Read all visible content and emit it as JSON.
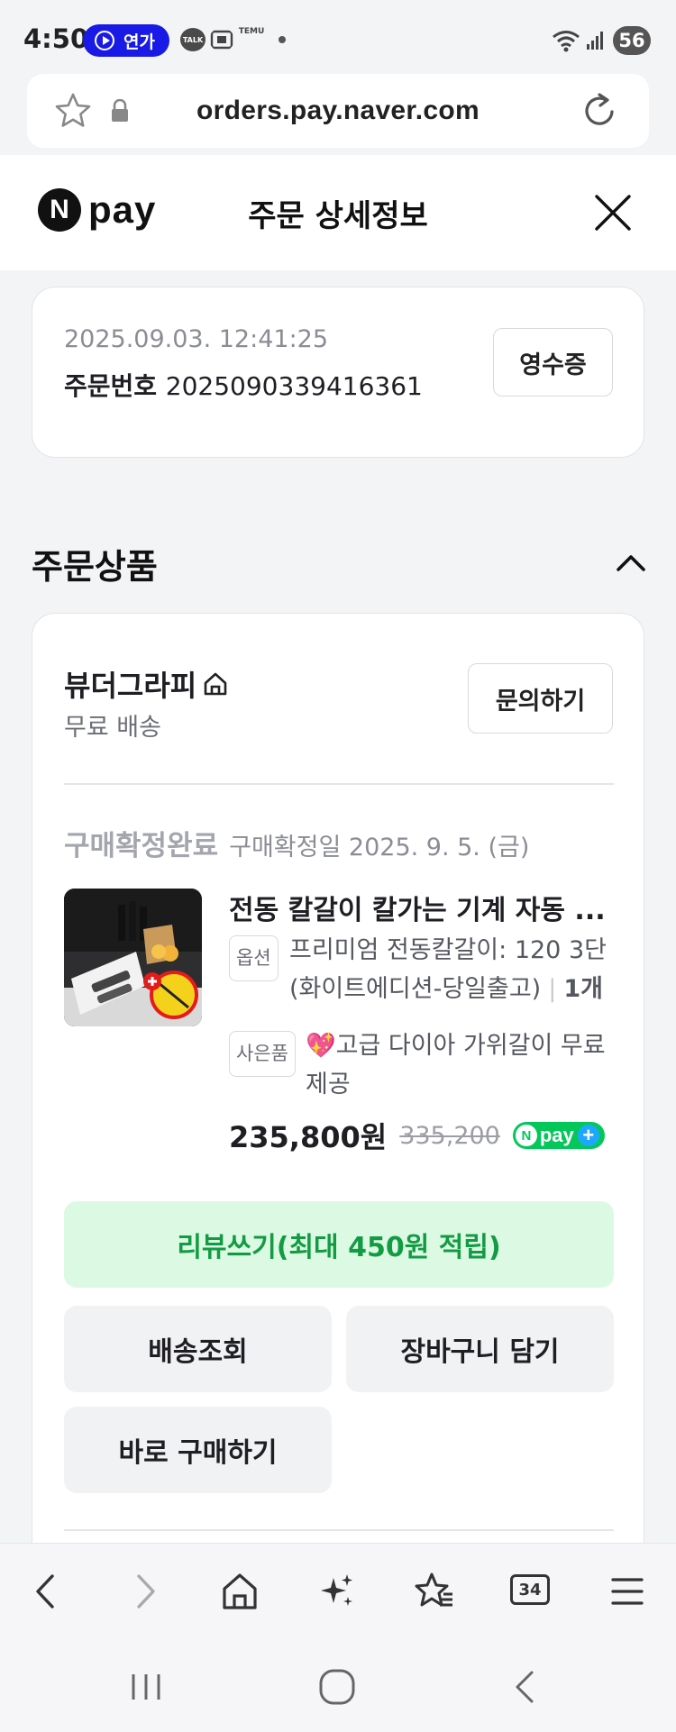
{
  "status_bar": {
    "time": "4:50",
    "media_label": "연가",
    "talk_label": "TALK",
    "temu_label": "TEMU",
    "battery": "56"
  },
  "address_bar": {
    "url": "orders.pay.naver.com"
  },
  "header": {
    "logo_text": "pay",
    "logo_mark": "N",
    "title": "주문 상세정보"
  },
  "order": {
    "datetime": "2025.09.03. 12:41:25",
    "number_label": "주문번호",
    "number": "2025090339416361",
    "receipt_button": "영수증"
  },
  "section": {
    "title": "주문상품"
  },
  "seller": {
    "name": "뷰더그라피",
    "shipping": "무료 배송",
    "inquiry_button": "문의하기"
  },
  "item": {
    "status": "구매확정완료",
    "confirm_date": "구매확정일 2025. 9. 5. (금)",
    "name": "전동 칼갈이 칼가는 기계 자동 ...",
    "option_tag": "옵션",
    "option_line1": "프리미엄 전동칼갈이: 120 3단",
    "option_line2": "(화이트에디션-당일출고)",
    "quantity": "1개",
    "gift_tag": "사은품",
    "gift_line1": "💖고급 다이아 가위갈이 무료",
    "gift_line2": "제공",
    "price": "235,800원",
    "original_price": "335,200",
    "npay_plus_badge": "pay"
  },
  "actions": {
    "review": "리뷰쓰기(최대 450원 적립)",
    "track": "배송조회",
    "cart": "장바구니 담기",
    "buy_now": "바로 구매하기"
  },
  "browser_toolbar": {
    "tab_count": "34"
  },
  "colors": {
    "brand_green": "#04c75a",
    "review_bg": "#dcfae3",
    "review_text": "#139b44",
    "media_pill": "#1a1ae6"
  }
}
